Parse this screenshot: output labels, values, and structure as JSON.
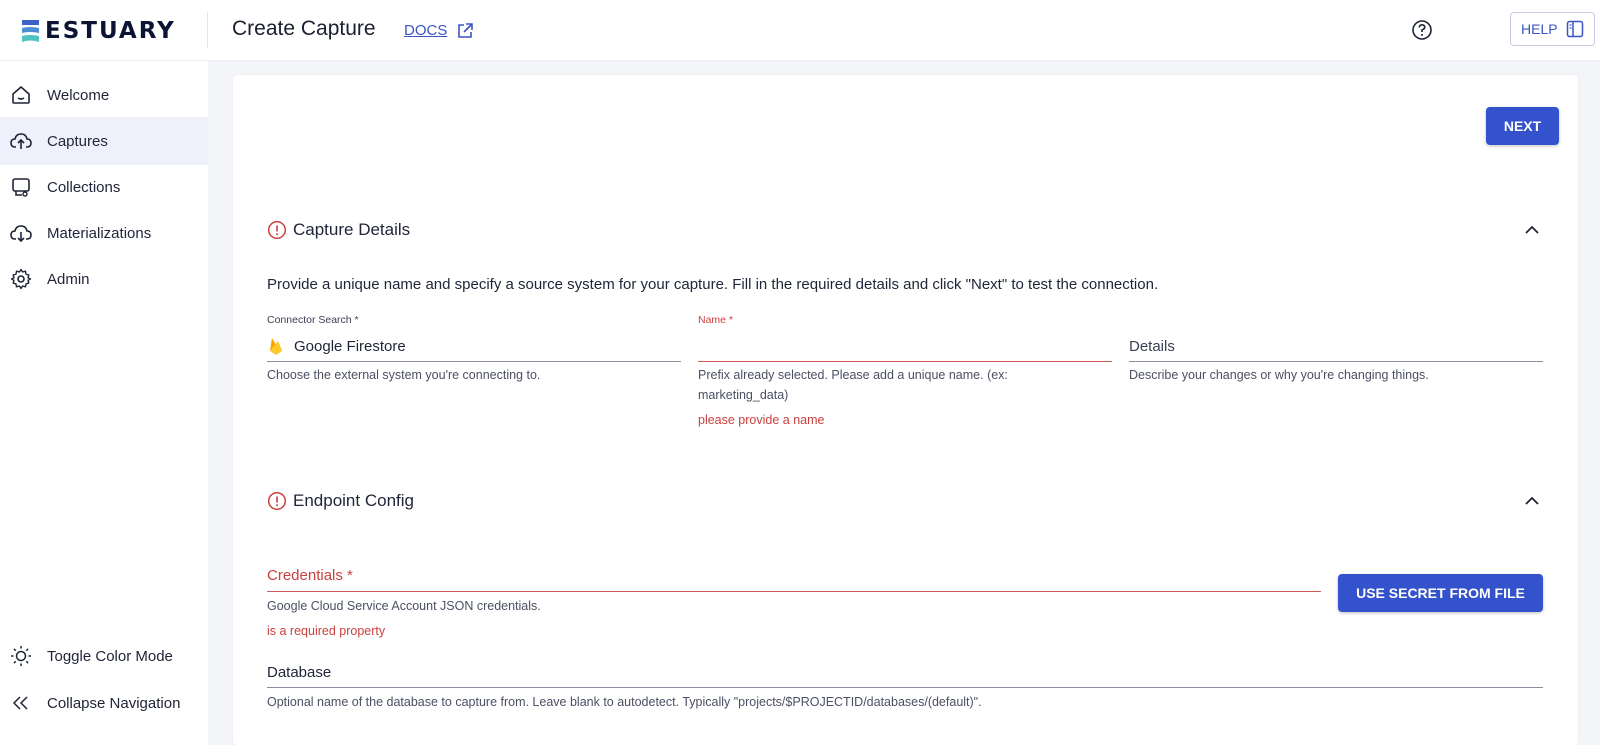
{
  "header": {
    "logo_text": "ESTUARY",
    "page_title": "Create Capture",
    "docs_label": "DOCS",
    "help_label": "HELP"
  },
  "sidebar": {
    "items": [
      {
        "label": "Welcome",
        "icon": "home-icon"
      },
      {
        "label": "Captures",
        "icon": "cloud-upload-icon",
        "active": true
      },
      {
        "label": "Collections",
        "icon": "collections-icon"
      },
      {
        "label": "Materializations",
        "icon": "cloud-download-icon"
      },
      {
        "label": "Admin",
        "icon": "gear-icon"
      }
    ],
    "bottom": [
      {
        "label": "Toggle Color Mode",
        "icon": "sun-icon"
      },
      {
        "label": "Collapse Navigation",
        "icon": "double-chevron-left-icon"
      }
    ]
  },
  "main": {
    "next_label": "NEXT",
    "capture_details": {
      "title": "Capture Details",
      "intro": "Provide a unique name and specify a source system for your capture. Fill in the required details and click \"Next\" to test the connection.",
      "connector": {
        "label": "Connector Search *",
        "value": "Google Firestore",
        "helper": "Choose the external system you're connecting to."
      },
      "name": {
        "label": "Name *",
        "value": "",
        "helper": "Prefix already selected. Please add a unique name. (ex: marketing_data)",
        "error": "please provide a name"
      },
      "details": {
        "placeholder": "Details",
        "helper": "Describe your changes or why you're changing things."
      }
    },
    "endpoint_config": {
      "title": "Endpoint Config",
      "credentials": {
        "label": "Credentials *",
        "helper": "Google Cloud Service Account JSON credentials.",
        "error": "is a required property"
      },
      "secret_button_label": "USE SECRET FROM FILE",
      "database": {
        "label": "Database",
        "helper": "Optional name of the database to capture from. Leave blank to autodetect. Typically \"projects/$PROJECTID/databases/(default)\"."
      }
    }
  },
  "colors": {
    "accent": "#3552cd",
    "error": "#c9413f",
    "sidebar_active": "#eef0fb",
    "logo_teal": "#4fc3c0",
    "logo_blue": "#3a62c9"
  }
}
